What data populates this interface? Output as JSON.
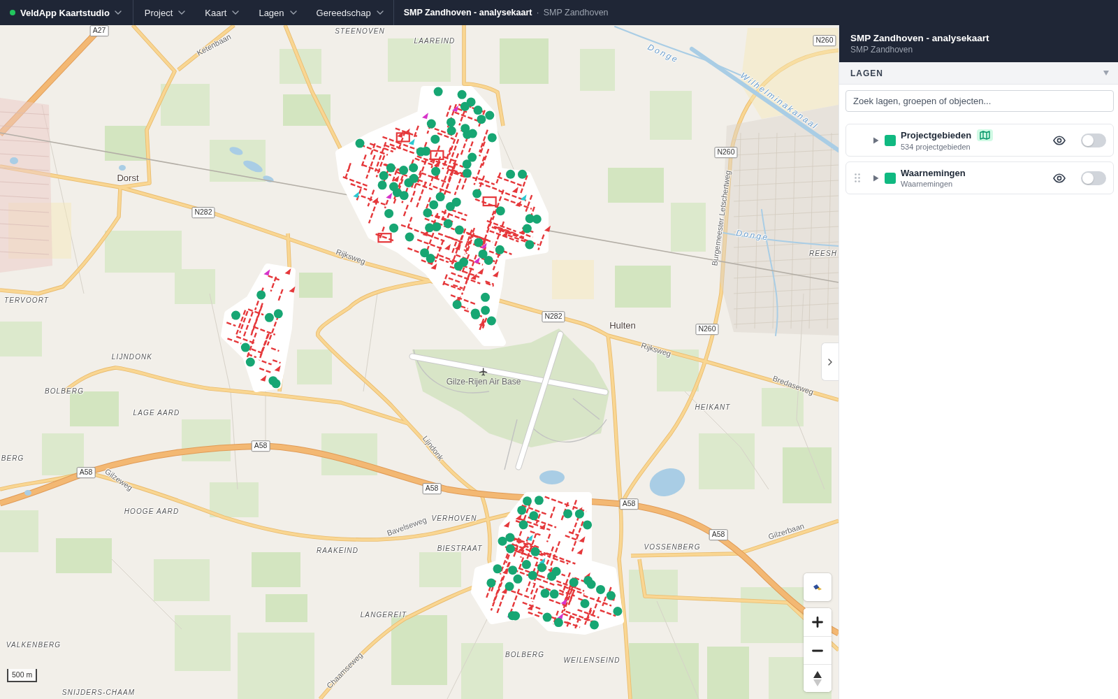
{
  "app_bar": {
    "brand": "VeldApp Kaartstudio",
    "menus": [
      "Project",
      "Kaart",
      "Lagen",
      "Gereedschap"
    ],
    "document": {
      "title": "SMP Zandhoven - analysekaart",
      "separator": "·",
      "subtitle": "SMP Zandhoven"
    }
  },
  "map": {
    "labels": [
      {
        "kind": "shield",
        "text": "A27"
      },
      {
        "kind": "road",
        "text": "Ketenbaan"
      },
      {
        "kind": "hamlet",
        "text": "STEENOVEN"
      },
      {
        "kind": "hamlet",
        "text": "LAAREIND"
      },
      {
        "kind": "water",
        "text": "Donge"
      },
      {
        "kind": "shield",
        "text": "N260"
      },
      {
        "kind": "water",
        "text": "Wilhelminakanaal"
      },
      {
        "kind": "shield",
        "text": "N260"
      },
      {
        "kind": "road",
        "text": "Burgemeester Letschertweg"
      },
      {
        "kind": "water",
        "text": "Donge"
      },
      {
        "kind": "hamlet",
        "text": "REESH"
      },
      {
        "kind": "town",
        "text": "Dorst"
      },
      {
        "kind": "shield",
        "text": "N282"
      },
      {
        "kind": "road",
        "text": "Rijksweg"
      },
      {
        "kind": "hamlet",
        "text": "TERVOORT"
      },
      {
        "kind": "shield",
        "text": "N282"
      },
      {
        "kind": "town",
        "text": "Hulten"
      },
      {
        "kind": "shield",
        "text": "N260"
      },
      {
        "kind": "road",
        "text": "Rijksweg"
      },
      {
        "kind": "hamlet",
        "text": "LIJNDONK"
      },
      {
        "kind": "airport",
        "text": "Gilze-Rijen Air Base"
      },
      {
        "kind": "road",
        "text": "Bredaseweg"
      },
      {
        "kind": "hamlet",
        "text": "BOLBERG"
      },
      {
        "kind": "hamlet",
        "text": "LAGE AARD"
      },
      {
        "kind": "hamlet",
        "text": "HEIKANT"
      },
      {
        "kind": "shield",
        "text": "A58"
      },
      {
        "kind": "road",
        "text": "Lijndonk"
      },
      {
        "kind": "hamlet",
        "text": "BERG"
      },
      {
        "kind": "shield",
        "text": "A58"
      },
      {
        "kind": "road",
        "text": "Gilzeweg"
      },
      {
        "kind": "shield",
        "text": "A58"
      },
      {
        "kind": "shield",
        "text": "A58"
      },
      {
        "kind": "hamlet",
        "text": "HOOGE AARD"
      },
      {
        "kind": "hamlet",
        "text": "VERHOVEN"
      },
      {
        "kind": "road",
        "text": "Bavelseweg"
      },
      {
        "kind": "road",
        "text": "Gilzerbaan"
      },
      {
        "kind": "shield",
        "text": "A58"
      },
      {
        "kind": "hamlet",
        "text": "RAAKEIND"
      },
      {
        "kind": "hamlet",
        "text": "BIESTRAAT"
      },
      {
        "kind": "hamlet",
        "text": "VOSSENBERG"
      },
      {
        "kind": "hamlet",
        "text": "LANGEREIT"
      },
      {
        "kind": "hamlet",
        "text": "VALKENBERG"
      },
      {
        "kind": "hamlet",
        "text": "BOLBERG"
      },
      {
        "kind": "hamlet",
        "text": "WEILENSEIND"
      },
      {
        "kind": "road",
        "text": "Chaamseweg"
      },
      {
        "kind": "hamlet",
        "text": "SNIJDERS-CHAAM"
      }
    ],
    "scale": "500 m"
  },
  "panel": {
    "title": "SMP Zandhoven - analysekaart",
    "subtitle": "SMP Zandhoven",
    "section": {
      "title": "LAGEN",
      "expanded": true
    },
    "search": {
      "placeholder": "Zoek lagen, groepen of objecten..."
    },
    "layers": [
      {
        "name": "Projectgebieden",
        "detail": "534 projectgebieden",
        "expanded": false,
        "drag_handle": false,
        "map_badge": true,
        "visible": true,
        "on": false
      },
      {
        "name": "Waarnemingen",
        "detail": "Waarnemingen",
        "expanded": false,
        "drag_handle": true,
        "map_badge": false,
        "visible": true,
        "on": false
      }
    ]
  }
}
